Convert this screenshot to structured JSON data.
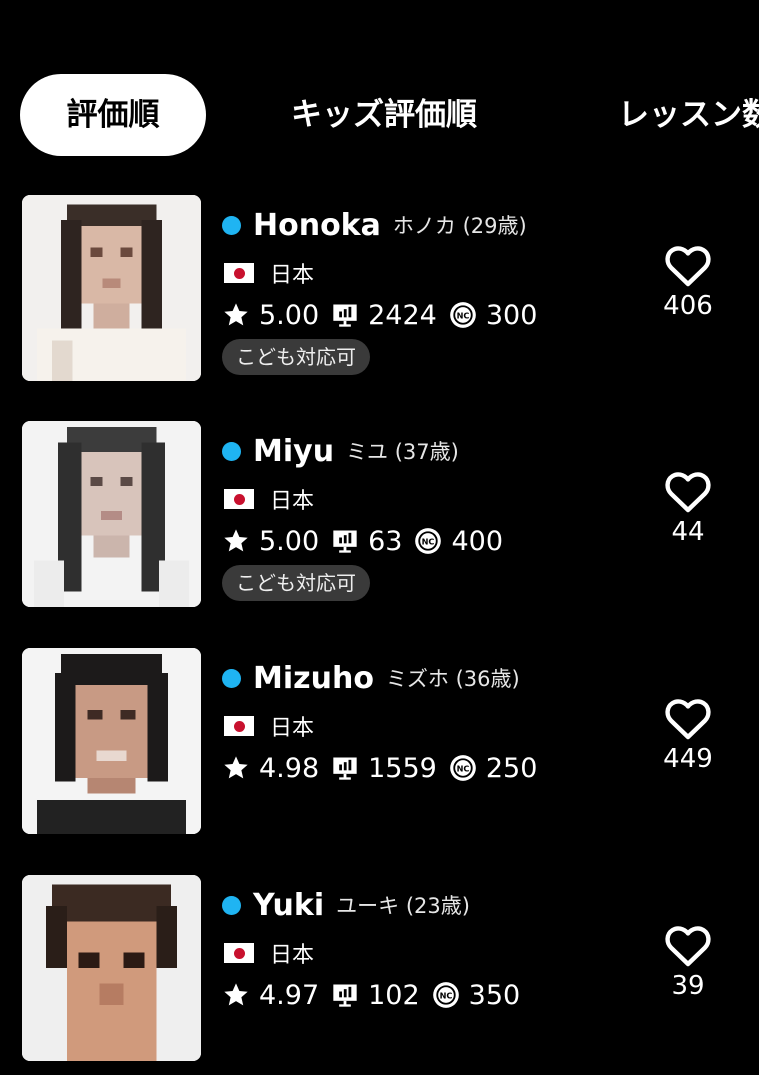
{
  "tabs": [
    {
      "label": "評価順",
      "active": true
    },
    {
      "label": "キッズ評価順",
      "active": false
    },
    {
      "label": "レッスン数",
      "active": false
    }
  ],
  "colors": {
    "background": "#000000",
    "online": "#1fb4f2",
    "badge_bg": "#3a3a3a",
    "active_tab_bg": "#ffffff"
  },
  "icons": {
    "rating": "star-icon",
    "lessons": "lesson-board-icon",
    "coin": "nc-coin-icon",
    "favorite": "heart-outline-icon",
    "country": "japan-flag-icon"
  },
  "teachers": [
    {
      "name": "Honoka",
      "kana": "ホノカ (29歳)",
      "country": "日本",
      "rating": "5.00",
      "lessons": "2424",
      "coins": "300",
      "badge": "こども対応可",
      "likes": "406"
    },
    {
      "name": "Miyu",
      "kana": "ミユ (37歳)",
      "country": "日本",
      "rating": "5.00",
      "lessons": "63",
      "coins": "400",
      "badge": "こども対応可",
      "likes": "44"
    },
    {
      "name": "Mizuho",
      "kana": "ミズホ (36歳)",
      "country": "日本",
      "rating": "4.98",
      "lessons": "1559",
      "coins": "250",
      "badge": "",
      "likes": "449"
    },
    {
      "name": "Yuki",
      "kana": "ユーキ (23歳)",
      "country": "日本",
      "rating": "4.97",
      "lessons": "102",
      "coins": "350",
      "badge": "",
      "likes": "39"
    }
  ]
}
